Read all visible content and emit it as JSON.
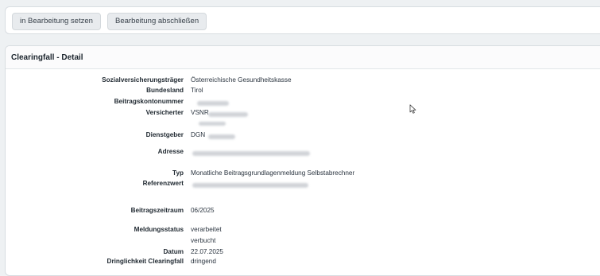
{
  "toolbar": {
    "btn_in_bearbeitung": "in Bearbeitung setzen",
    "btn_abschliessen": "Bearbeitung abschließen"
  },
  "detail": {
    "title": "Clearingfall - Detail",
    "fields": {
      "sv_traeger_label": "Sozialversicherungsträger",
      "sv_traeger_value": "Österreichische Gesundheitskasse",
      "bundesland_label": "Bundesland",
      "bundesland_value": "Tirol",
      "beitragskonto_label": "Beitragskontonummer",
      "versicherter_label": "Versicherter",
      "versicherter_prefix": "VSNR",
      "dienstgeber_label": "Dienstgeber",
      "dienstgeber_prefix": "DGN",
      "adresse_label": "Adresse",
      "typ_label": "Typ",
      "typ_value": "Monatliche Beitragsgrundlagenmeldung Selbstabrechner",
      "referenzwert_label": "Referenzwert",
      "beitragszeitraum_label": "Beitragszeitraum",
      "beitragszeitraum_value": "06/2025",
      "meldungsstatus_label": "Meldungsstatus",
      "meldungsstatus_value_1": "verarbeitet",
      "meldungsstatus_value_2": "verbucht",
      "datum_label": "Datum",
      "datum_value": "22.07.2025",
      "dringlichkeit_label": "Dringlichkeit Clearingfall",
      "dringlichkeit_value": "dringend"
    }
  },
  "icons": {
    "cursor": "mouse-pointer-icon"
  }
}
